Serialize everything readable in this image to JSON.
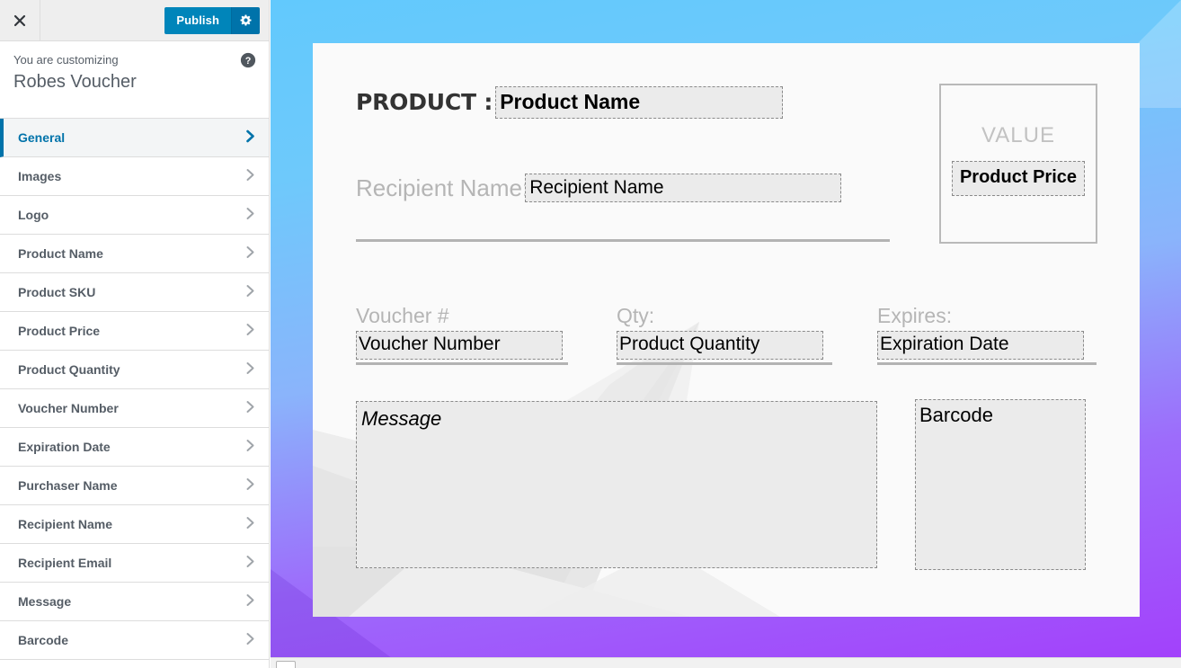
{
  "topbar": {
    "close_icon": "close-icon",
    "publish_label": "Publish",
    "gear_icon": "gear-icon"
  },
  "customizer_info": {
    "eyebrow": "You are customizing",
    "title": "Robes Voucher",
    "help_icon": "help-icon"
  },
  "sidebar": {
    "items": [
      {
        "label": "General",
        "active": true
      },
      {
        "label": "Images",
        "active": false
      },
      {
        "label": "Logo",
        "active": false
      },
      {
        "label": "Product Name",
        "active": false
      },
      {
        "label": "Product SKU",
        "active": false
      },
      {
        "label": "Product Price",
        "active": false
      },
      {
        "label": "Product Quantity",
        "active": false
      },
      {
        "label": "Voucher Number",
        "active": false
      },
      {
        "label": "Expiration Date",
        "active": false
      },
      {
        "label": "Purchaser Name",
        "active": false
      },
      {
        "label": "Recipient Name",
        "active": false
      },
      {
        "label": "Recipient Email",
        "active": false
      },
      {
        "label": "Message",
        "active": false
      },
      {
        "label": "Barcode",
        "active": false
      }
    ]
  },
  "voucher": {
    "product_label": "PRODUCT :",
    "product_name_placeholder": "Product Name",
    "recipient_label": "Recipient Name:",
    "recipient_name_placeholder": "Recipient Name",
    "value_title": "VALUE",
    "product_price_placeholder": "Product Price",
    "voucher_number_label": "Voucher #",
    "voucher_number_placeholder": "Voucher Number",
    "qty_label": "Qty:",
    "qty_placeholder": "Product Quantity",
    "expires_label": "Expires:",
    "expires_placeholder": "Expiration Date",
    "message_placeholder": "Message",
    "barcode_placeholder": "Barcode"
  },
  "colors": {
    "wp_blue": "#0073aa",
    "publish_blue": "#0085ba",
    "active_text": "#0073aa",
    "sidebar_text": "#555d66",
    "bg_top": "#62c9fd",
    "bg_bottom": "#a33ffb",
    "card_bg": "#fafafa",
    "placeholder_bg": "#ebebeb",
    "placeholder_border": "#8a8a8a",
    "muted_label": "#b5b5b5"
  }
}
